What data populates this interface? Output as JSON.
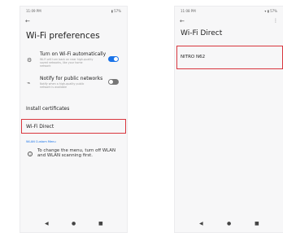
{
  "left": {
    "status_time": "11:09 PM",
    "status_right": "▮ 57%",
    "back": "←",
    "title": "Wi-Fi preferences",
    "rows": [
      {
        "title": "Turn on Wi-Fi automatically",
        "desc": "Wi-Fi will turn back on near high-quality saved networks, like your home network",
        "toggle": "on"
      },
      {
        "title": "Notify for public networks",
        "desc": "Notify when a high-quality public network is available",
        "toggle": "off"
      }
    ],
    "install_certificates": "Install certificates",
    "wifi_direct": "Wi-Fi Direct",
    "section_label": "WLAN Custom Menu",
    "info_text": "To change the menu, turn off WLAN and WLAN scanning first.",
    "nav": {
      "back": "◀",
      "home": "●",
      "recents": "■"
    }
  },
  "right": {
    "status_time": "11:08 PM",
    "status_right": "▾ ▮ 57%",
    "back": "←",
    "more": "⋮",
    "title": "Wi-Fi Direct",
    "device": "NITRO N62",
    "nav": {
      "back": "◀",
      "home": "●",
      "recents": "■"
    }
  },
  "colors": {
    "highlight": "#d9363e",
    "accent": "#1a73e8"
  }
}
